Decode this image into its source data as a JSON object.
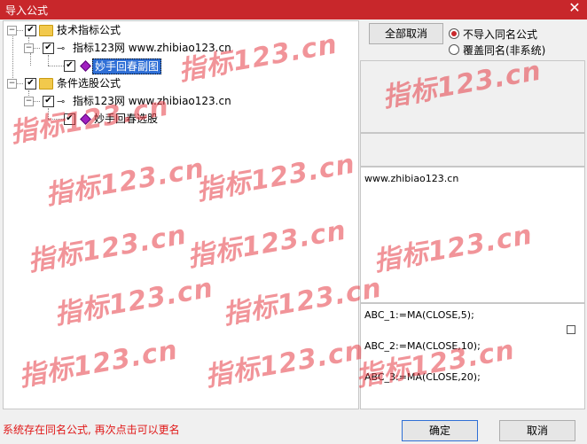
{
  "window": {
    "title": "导入公式",
    "close_glyph": "✕"
  },
  "tree": {
    "nodes": [
      {
        "expander": "−",
        "checked": true,
        "label": "技术指标公式"
      },
      {
        "expander": "−",
        "checked": true,
        "label": "指标123网 www.zhibiao123.cn"
      },
      {
        "checked": true,
        "label": "妙手回春副图",
        "selected": true
      },
      {
        "expander": "−",
        "checked": true,
        "label": "条件选股公式"
      },
      {
        "expander": "−",
        "checked": true,
        "label": "指标123网 www.zhibiao123.cn"
      },
      {
        "checked": true,
        "label": "妙手回春选股"
      }
    ]
  },
  "right": {
    "cancel_all_label": "全部取消",
    "radio": {
      "option_no_import": "不导入同名公式",
      "option_overwrite": "覆盖同名(非系统)",
      "selected": "option_no_import"
    },
    "info_text": "www.zhibiao123.cn",
    "code_lines": [
      "ABC_1:=MA(CLOSE,5);",
      "ABC_2:=MA(CLOSE,10);",
      "ABC_3:=MA(CLOSE,20);"
    ]
  },
  "status": {
    "message": "系统存在同名公式, 再次点击可以更名"
  },
  "buttons": {
    "ok_label": "确定",
    "cancel_label": "取消"
  },
  "watermark": {
    "text": "指标123.cn",
    "color": "#e63c46"
  },
  "colors": {
    "titlebar": "#c8272b",
    "selection": "#2f6fd6",
    "status": "#e01818"
  }
}
